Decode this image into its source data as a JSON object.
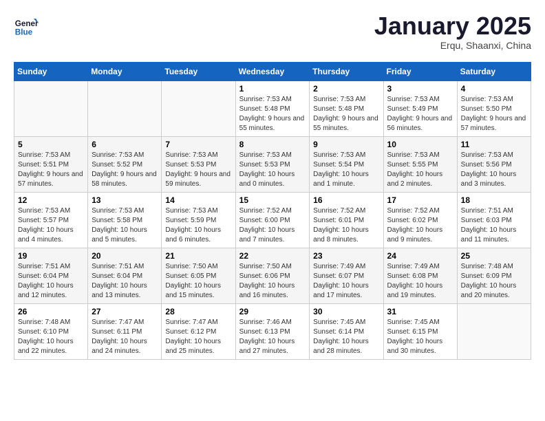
{
  "header": {
    "logo_line1": "General",
    "logo_line2": "Blue",
    "month": "January 2025",
    "location": "Erqu, Shaanxi, China"
  },
  "weekdays": [
    "Sunday",
    "Monday",
    "Tuesday",
    "Wednesday",
    "Thursday",
    "Friday",
    "Saturday"
  ],
  "weeks": [
    [
      {
        "day": "",
        "sunrise": "",
        "sunset": "",
        "daylight": ""
      },
      {
        "day": "",
        "sunrise": "",
        "sunset": "",
        "daylight": ""
      },
      {
        "day": "",
        "sunrise": "",
        "sunset": "",
        "daylight": ""
      },
      {
        "day": "1",
        "sunrise": "Sunrise: 7:53 AM",
        "sunset": "Sunset: 5:48 PM",
        "daylight": "Daylight: 9 hours and 55 minutes."
      },
      {
        "day": "2",
        "sunrise": "Sunrise: 7:53 AM",
        "sunset": "Sunset: 5:48 PM",
        "daylight": "Daylight: 9 hours and 55 minutes."
      },
      {
        "day": "3",
        "sunrise": "Sunrise: 7:53 AM",
        "sunset": "Sunset: 5:49 PM",
        "daylight": "Daylight: 9 hours and 56 minutes."
      },
      {
        "day": "4",
        "sunrise": "Sunrise: 7:53 AM",
        "sunset": "Sunset: 5:50 PM",
        "daylight": "Daylight: 9 hours and 57 minutes."
      }
    ],
    [
      {
        "day": "5",
        "sunrise": "Sunrise: 7:53 AM",
        "sunset": "Sunset: 5:51 PM",
        "daylight": "Daylight: 9 hours and 57 minutes."
      },
      {
        "day": "6",
        "sunrise": "Sunrise: 7:53 AM",
        "sunset": "Sunset: 5:52 PM",
        "daylight": "Daylight: 9 hours and 58 minutes."
      },
      {
        "day": "7",
        "sunrise": "Sunrise: 7:53 AM",
        "sunset": "Sunset: 5:53 PM",
        "daylight": "Daylight: 9 hours and 59 minutes."
      },
      {
        "day": "8",
        "sunrise": "Sunrise: 7:53 AM",
        "sunset": "Sunset: 5:53 PM",
        "daylight": "Daylight: 10 hours and 0 minutes."
      },
      {
        "day": "9",
        "sunrise": "Sunrise: 7:53 AM",
        "sunset": "Sunset: 5:54 PM",
        "daylight": "Daylight: 10 hours and 1 minute."
      },
      {
        "day": "10",
        "sunrise": "Sunrise: 7:53 AM",
        "sunset": "Sunset: 5:55 PM",
        "daylight": "Daylight: 10 hours and 2 minutes."
      },
      {
        "day": "11",
        "sunrise": "Sunrise: 7:53 AM",
        "sunset": "Sunset: 5:56 PM",
        "daylight": "Daylight: 10 hours and 3 minutes."
      }
    ],
    [
      {
        "day": "12",
        "sunrise": "Sunrise: 7:53 AM",
        "sunset": "Sunset: 5:57 PM",
        "daylight": "Daylight: 10 hours and 4 minutes."
      },
      {
        "day": "13",
        "sunrise": "Sunrise: 7:53 AM",
        "sunset": "Sunset: 5:58 PM",
        "daylight": "Daylight: 10 hours and 5 minutes."
      },
      {
        "day": "14",
        "sunrise": "Sunrise: 7:53 AM",
        "sunset": "Sunset: 5:59 PM",
        "daylight": "Daylight: 10 hours and 6 minutes."
      },
      {
        "day": "15",
        "sunrise": "Sunrise: 7:52 AM",
        "sunset": "Sunset: 6:00 PM",
        "daylight": "Daylight: 10 hours and 7 minutes."
      },
      {
        "day": "16",
        "sunrise": "Sunrise: 7:52 AM",
        "sunset": "Sunset: 6:01 PM",
        "daylight": "Daylight: 10 hours and 8 minutes."
      },
      {
        "day": "17",
        "sunrise": "Sunrise: 7:52 AM",
        "sunset": "Sunset: 6:02 PM",
        "daylight": "Daylight: 10 hours and 9 minutes."
      },
      {
        "day": "18",
        "sunrise": "Sunrise: 7:51 AM",
        "sunset": "Sunset: 6:03 PM",
        "daylight": "Daylight: 10 hours and 11 minutes."
      }
    ],
    [
      {
        "day": "19",
        "sunrise": "Sunrise: 7:51 AM",
        "sunset": "Sunset: 6:04 PM",
        "daylight": "Daylight: 10 hours and 12 minutes."
      },
      {
        "day": "20",
        "sunrise": "Sunrise: 7:51 AM",
        "sunset": "Sunset: 6:04 PM",
        "daylight": "Daylight: 10 hours and 13 minutes."
      },
      {
        "day": "21",
        "sunrise": "Sunrise: 7:50 AM",
        "sunset": "Sunset: 6:05 PM",
        "daylight": "Daylight: 10 hours and 15 minutes."
      },
      {
        "day": "22",
        "sunrise": "Sunrise: 7:50 AM",
        "sunset": "Sunset: 6:06 PM",
        "daylight": "Daylight: 10 hours and 16 minutes."
      },
      {
        "day": "23",
        "sunrise": "Sunrise: 7:49 AM",
        "sunset": "Sunset: 6:07 PM",
        "daylight": "Daylight: 10 hours and 17 minutes."
      },
      {
        "day": "24",
        "sunrise": "Sunrise: 7:49 AM",
        "sunset": "Sunset: 6:08 PM",
        "daylight": "Daylight: 10 hours and 19 minutes."
      },
      {
        "day": "25",
        "sunrise": "Sunrise: 7:48 AM",
        "sunset": "Sunset: 6:09 PM",
        "daylight": "Daylight: 10 hours and 20 minutes."
      }
    ],
    [
      {
        "day": "26",
        "sunrise": "Sunrise: 7:48 AM",
        "sunset": "Sunset: 6:10 PM",
        "daylight": "Daylight: 10 hours and 22 minutes."
      },
      {
        "day": "27",
        "sunrise": "Sunrise: 7:47 AM",
        "sunset": "Sunset: 6:11 PM",
        "daylight": "Daylight: 10 hours and 24 minutes."
      },
      {
        "day": "28",
        "sunrise": "Sunrise: 7:47 AM",
        "sunset": "Sunset: 6:12 PM",
        "daylight": "Daylight: 10 hours and 25 minutes."
      },
      {
        "day": "29",
        "sunrise": "Sunrise: 7:46 AM",
        "sunset": "Sunset: 6:13 PM",
        "daylight": "Daylight: 10 hours and 27 minutes."
      },
      {
        "day": "30",
        "sunrise": "Sunrise: 7:45 AM",
        "sunset": "Sunset: 6:14 PM",
        "daylight": "Daylight: 10 hours and 28 minutes."
      },
      {
        "day": "31",
        "sunrise": "Sunrise: 7:45 AM",
        "sunset": "Sunset: 6:15 PM",
        "daylight": "Daylight: 10 hours and 30 minutes."
      },
      {
        "day": "",
        "sunrise": "",
        "sunset": "",
        "daylight": ""
      }
    ]
  ]
}
